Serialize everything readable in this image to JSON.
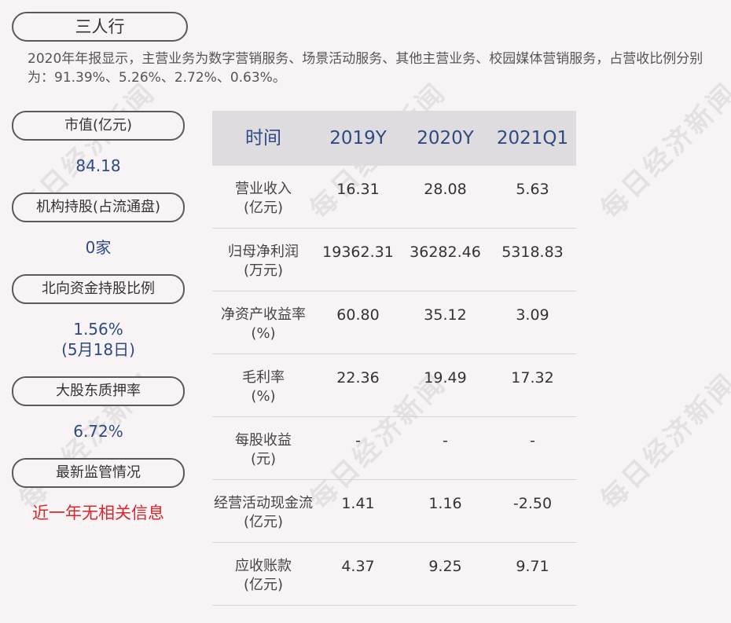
{
  "company": "三人行",
  "intro": "2020年年报显示，主营业务为数字营销服务、场景活动服务、其他主营业务、校园媒体营销服务，占营收比例分别为：91.39%、5.26%、2.72%、0.63%。",
  "watermark": "每日经济新闻",
  "left": {
    "market_cap_label": "市值(亿元)",
    "market_cap_value": "84.18",
    "institution_label": "机构持股(占流通盘)",
    "institution_value": "0家",
    "northbound_label": "北向资金持股比例",
    "northbound_value": "1.56%",
    "northbound_date": "(5月18日)",
    "pledge_label": "大股东质押率",
    "pledge_value": "6.72%",
    "regulation_label": "最新监管情况",
    "regulation_value": "近一年无相关信息"
  },
  "table": {
    "header": {
      "label": "时间",
      "cols": [
        "2019Y",
        "2020Y",
        "2021Q1"
      ]
    },
    "rows": [
      {
        "label1": "营业收入",
        "label2": "(亿元)",
        "values": [
          "16.31",
          "28.08",
          "5.63"
        ]
      },
      {
        "label1": "归母净利润",
        "label2": "(万元)",
        "values": [
          "19362.31",
          "36282.46",
          "5318.83"
        ]
      },
      {
        "label1": "净资产收益率",
        "label2": "(%)",
        "values": [
          "60.80",
          "35.12",
          "3.09"
        ]
      },
      {
        "label1": "毛利率",
        "label2": "(%)",
        "values": [
          "22.36",
          "19.49",
          "17.32"
        ]
      },
      {
        "label1": "每股收益",
        "label2": "(元)",
        "values": [
          "-",
          "-",
          "-"
        ]
      },
      {
        "label1": "经营活动现金流",
        "label2": "(亿元)",
        "values": [
          "1.41",
          "1.16",
          "-2.50"
        ]
      },
      {
        "label1": "应收账款",
        "label2": "(亿元)",
        "values": [
          "4.37",
          "9.25",
          "9.71"
        ]
      }
    ]
  },
  "colors": {
    "background": "#f8f4f6",
    "accent_blue": "#2e4a84",
    "alert_red": "#d9262b",
    "header_gray": "#dedcde"
  }
}
